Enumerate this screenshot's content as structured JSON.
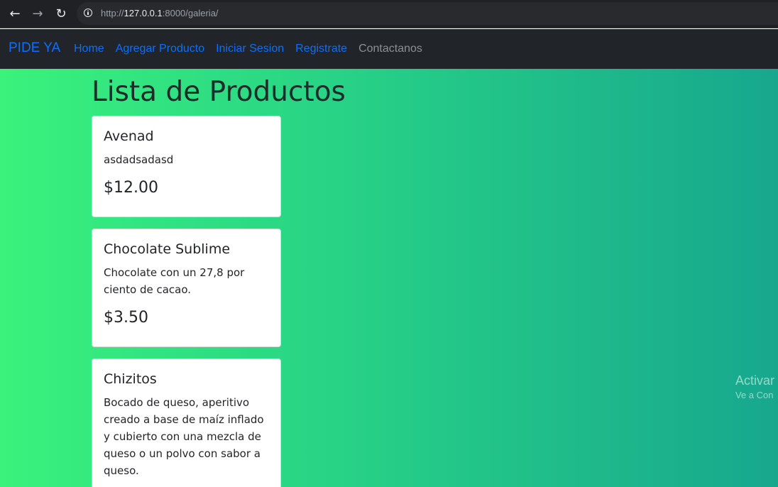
{
  "browser": {
    "url_scheme": "http://",
    "url_host": "127.0.0.1",
    "url_rest": ":8000/galeria/",
    "back_icon": "back-arrow-icon",
    "forward_icon": "forward-arrow-icon",
    "reload_icon": "reload-icon",
    "info_icon": "info-icon"
  },
  "navbar": {
    "brand": "PIDE YA",
    "links": [
      {
        "label": "Home"
      },
      {
        "label": "Agregar Producto"
      },
      {
        "label": "Iniciar Sesion"
      },
      {
        "label": "Registrate"
      },
      {
        "label": "Contactanos"
      }
    ]
  },
  "main": {
    "title": "Lista de Productos",
    "products": [
      {
        "name": "Avenad",
        "description": "asdadsadasd",
        "price": "$12.00"
      },
      {
        "name": "Chocolate Sublime",
        "description": "Chocolate con un 27,8 por ciento de cacao.",
        "price": "$3.50"
      },
      {
        "name": "Chizitos",
        "description": "Bocado de queso, aperitivo creado a base de maíz inflado y cubierto con una mezcla de queso o un polvo con sabor a queso.",
        "price": ""
      }
    ]
  },
  "watermark": {
    "line1": "Activar",
    "line2": "Ve a Con"
  },
  "colors": {
    "nav_link": "#0d6efd",
    "navbar_bg": "#212529",
    "gradient_start": "#3af27c",
    "gradient_end": "#17a78e"
  }
}
